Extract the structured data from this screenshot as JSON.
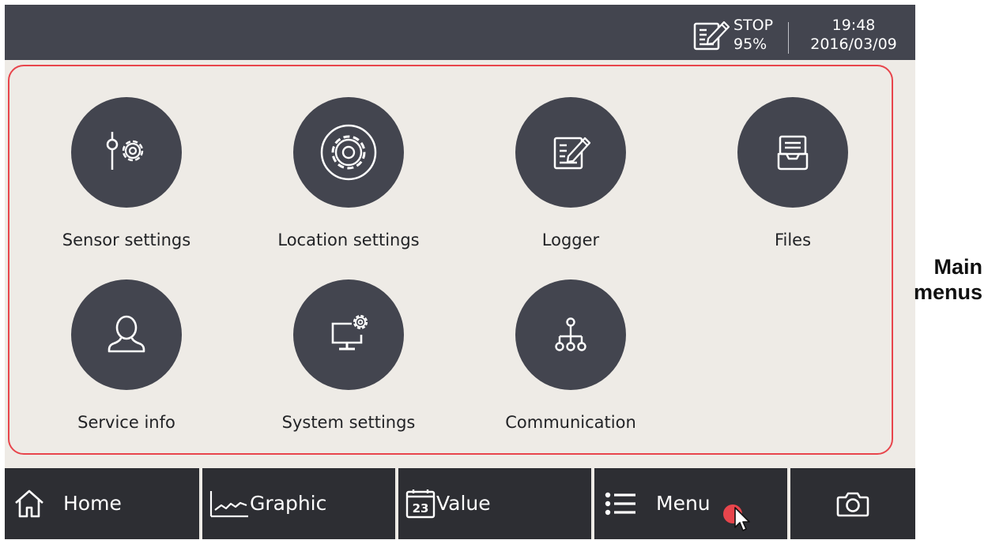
{
  "status_bar": {
    "logger_icon": "logger-icon",
    "state": "STOP",
    "battery": "95%",
    "time": "19:48",
    "date": "2016/03/09"
  },
  "menu": {
    "items": [
      {
        "label": "Sensor settings",
        "icon": "sensor-settings-icon"
      },
      {
        "label": "Location settings",
        "icon": "gear-icon"
      },
      {
        "label": "Logger",
        "icon": "logger-icon"
      },
      {
        "label": "Files",
        "icon": "inbox-tray-icon"
      },
      {
        "label": "Service info",
        "icon": "user-icon"
      },
      {
        "label": "System settings",
        "icon": "monitor-gear-icon"
      },
      {
        "label": "Communication",
        "icon": "network-tree-icon"
      }
    ]
  },
  "nav": {
    "home": "Home",
    "graphic": "Graphic",
    "value_icon_text": "23",
    "value": "Value",
    "menu": "Menu",
    "camera_icon": "camera-icon"
  },
  "annotation": {
    "line1": "Main",
    "line2": "menus"
  },
  "colors": {
    "header_bg": "#43454f",
    "screen_bg": "#eeebe6",
    "tile_circle": "#43454f",
    "nav_bg": "#2d2e33",
    "frame_border": "#e8454c",
    "click_indicator": "#e8454c"
  }
}
